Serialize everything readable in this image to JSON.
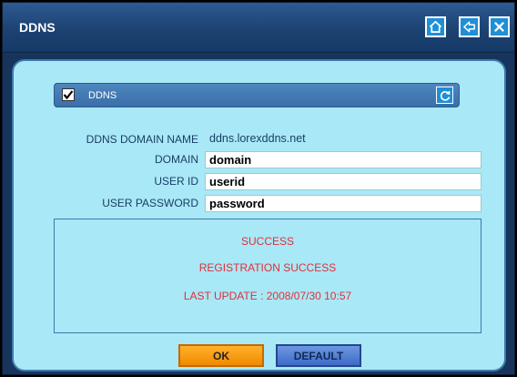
{
  "window": {
    "title": "DDNS"
  },
  "titlebar_buttons": [
    {
      "icon": "home-icon"
    },
    {
      "icon": "back-arrow-icon"
    },
    {
      "icon": "close-icon"
    }
  ],
  "section": {
    "label": "DDNS",
    "checked": true,
    "refresh_icon": "refresh-icon"
  },
  "form": {
    "ddns_domain_name_label": "DDNS DOMAIN NAME",
    "ddns_domain_name_value": "ddns.lorexddns.net",
    "domain_label": "DOMAIN",
    "domain_value": "domain",
    "user_id_label": "USER ID",
    "user_id_value": "userid",
    "user_password_label": "USER PASSWORD",
    "user_password_value": "password"
  },
  "status": {
    "line1": "SUCCESS",
    "line2": "REGISTRATION SUCCESS",
    "line3": "LAST UPDATE : 2008/07/30  10:57"
  },
  "buttons": {
    "ok": "OK",
    "default": "DEFAULT"
  },
  "colors": {
    "title_bar": "#1c4273",
    "panel": "#a9e8f6",
    "status_text": "#e0303a",
    "ok": "#f59a10",
    "default": "#4b78d0"
  }
}
